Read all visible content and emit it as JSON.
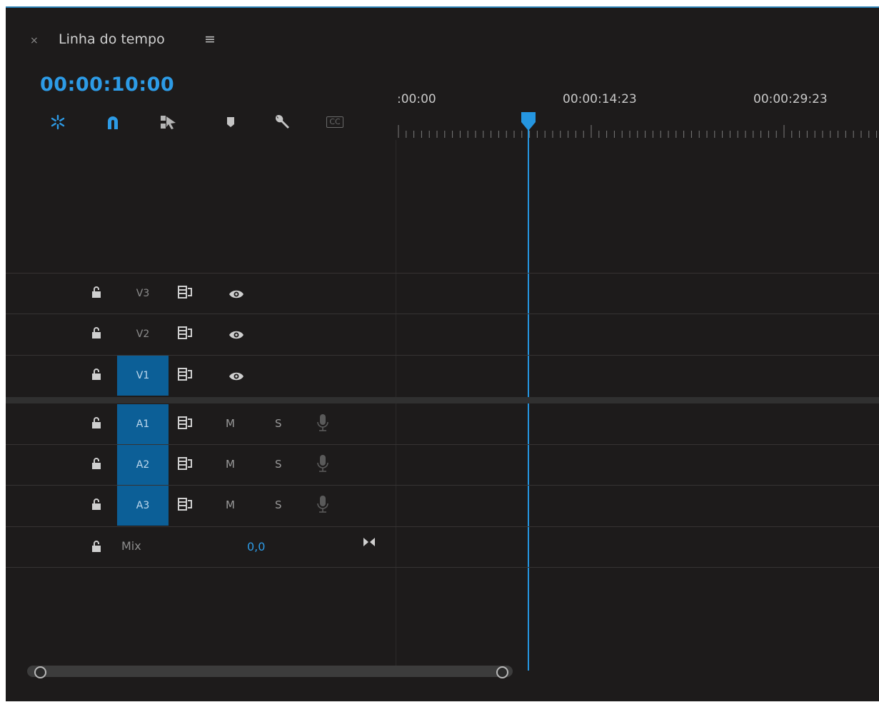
{
  "panel": {
    "close_glyph": "×",
    "title": "Linha do tempo",
    "menu_glyph": "≡"
  },
  "timecode": "00:00:10:00",
  "toolbar": {
    "icons": [
      "insert-overwrite-sequences-icon",
      "snap-magnet-icon",
      "linked-selection-icon",
      "add-marker-icon",
      "timeline-settings-wrench-icon",
      "captions-icon"
    ],
    "captions_label": "CC"
  },
  "ruler": {
    "labels": [
      ":00:00",
      "00:00:14:23",
      "00:00:29:23"
    ]
  },
  "video_tracks": [
    {
      "name": "V3",
      "targeted": false
    },
    {
      "name": "V2",
      "targeted": false
    },
    {
      "name": "V1",
      "targeted": true
    }
  ],
  "audio_tracks": [
    {
      "name": "A1",
      "targeted": true,
      "mute": "M",
      "solo": "S"
    },
    {
      "name": "A2",
      "targeted": true,
      "mute": "M",
      "solo": "S"
    },
    {
      "name": "A3",
      "targeted": true,
      "mute": "M",
      "solo": "S"
    }
  ],
  "mix": {
    "label": "Mix",
    "value": "0,0"
  },
  "colors": {
    "accent": "#2d9be6",
    "panel_bg": "#1d1b1b",
    "track_active": "#0c5f97"
  }
}
